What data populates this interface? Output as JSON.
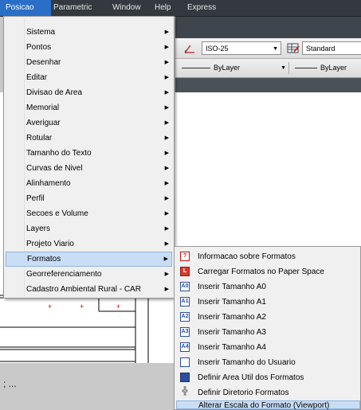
{
  "menubar": {
    "items": [
      "Posicao",
      "Parametric",
      "Window",
      "Help",
      "Express"
    ],
    "active": "Posicao"
  },
  "toolbar": {
    "dimstyle_value": "ISO-25",
    "tablestyle_value": "Standard",
    "linetype_value": "ByLayer",
    "lineweight_value": "ByLayer"
  },
  "menu": {
    "items": [
      {
        "label": "Sistema"
      },
      {
        "label": "Pontos"
      },
      {
        "label": "Desenhar"
      },
      {
        "label": "Editar"
      },
      {
        "label": "Divisao de Area"
      },
      {
        "label": "Memorial"
      },
      {
        "label": "Averiguar"
      },
      {
        "label": "Rotular"
      },
      {
        "label": "Tamanho do Texto"
      },
      {
        "label": "Curvas de Nivel"
      },
      {
        "label": "Alinhamento"
      },
      {
        "label": "Perfil"
      },
      {
        "label": "Secoes e Volume"
      },
      {
        "label": "Layers"
      },
      {
        "label": "Projeto Viario"
      },
      {
        "label": "Formatos"
      },
      {
        "label": "Georreferenciamento"
      },
      {
        "label": "Cadastro Ambiental Rural - CAR"
      }
    ],
    "highlighted": "Formatos"
  },
  "submenu": {
    "items": [
      {
        "label": "Informacao sobre Formatos",
        "icon": "warning-icon"
      },
      {
        "label": "Carregar Formatos no Paper Space",
        "icon": "load-icon"
      },
      {
        "label": "Inserir Tamanho A0",
        "icon": "a0-icon"
      },
      {
        "label": "Inserir Tamanho A1",
        "icon": "a1-icon"
      },
      {
        "label": "Inserir Tamanho A2",
        "icon": "a2-icon"
      },
      {
        "label": "Inserir Tamanho A3",
        "icon": "a3-icon"
      },
      {
        "label": "Inserir Tamanho A4",
        "icon": "a4-icon"
      },
      {
        "label": "Inserir Tamanho do Usuario",
        "icon": "user-size-icon"
      },
      {
        "label": "Definir Area Util dos Formatos",
        "icon": "area-icon"
      },
      {
        "label": "Definir Diretorio Formatos",
        "icon": "directory-icon"
      },
      {
        "label": "Alterar Escala do Formato (Viewport)",
        "icon": ""
      }
    ],
    "highlighted": "Alterar Escala do Formato (Viewport)"
  },
  "command_line": {
    "prompt": "; ..."
  },
  "colors": {
    "menubar_bg": "#33393f",
    "menubar_active": "#2a6fc7",
    "menu_bg": "#f0f0f0",
    "highlight_bg": "#c9def5",
    "drawing_marks": "#d00000"
  }
}
